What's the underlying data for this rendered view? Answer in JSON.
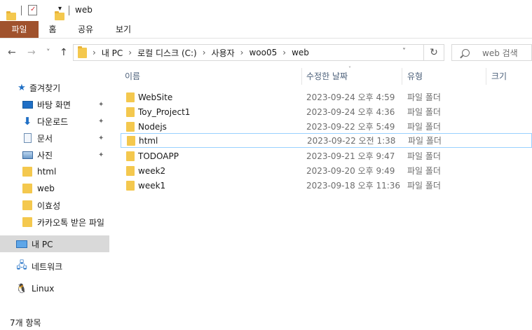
{
  "title": {
    "text": "web",
    "dropdown_glyph": "▾"
  },
  "ribbon": {
    "tabs": [
      {
        "label": "파일",
        "active": true
      },
      {
        "label": "홈"
      },
      {
        "label": "공유"
      },
      {
        "label": "보기"
      }
    ]
  },
  "nav": {
    "back": "←",
    "forward": "→",
    "recent": "˅",
    "up": "↑",
    "address": {
      "crumbs": [
        "내 PC",
        "로컬 디스크 (C:)",
        "사용자",
        "woo05",
        "web"
      ],
      "chevron": "›",
      "dropdown": "˅"
    },
    "refresh": "↻",
    "search_placeholder": "web 검색"
  },
  "sidebar": {
    "items": [
      {
        "label": "즐겨찾기",
        "icon": "star-icon"
      },
      {
        "label": "바탕 화면",
        "icon": "desktop-icon",
        "pinned": true
      },
      {
        "label": "다운로드",
        "icon": "download-icon",
        "pinned": true
      },
      {
        "label": "문서",
        "icon": "document-icon",
        "pinned": true
      },
      {
        "label": "사진",
        "icon": "pictures-icon",
        "pinned": true
      },
      {
        "label": "html",
        "icon": "folder-icon"
      },
      {
        "label": "web",
        "icon": "folder-icon"
      },
      {
        "label": "이효성",
        "icon": "folder-icon"
      },
      {
        "label": "카카오톡 받은 파일",
        "icon": "folder-icon"
      },
      {
        "label": "내 PC",
        "icon": "pc-icon",
        "selected": true
      },
      {
        "label": "네트워크",
        "icon": "network-icon"
      },
      {
        "label": "Linux",
        "icon": "linux-icon"
      }
    ],
    "pin_glyph": "📌"
  },
  "columns": {
    "name": "이름",
    "modified": "수정한 날짜",
    "type": "유형",
    "size": "크기"
  },
  "files": [
    {
      "name": "WebSite",
      "modified": "2023-09-24 오후 4:59",
      "type": "파일 폴더"
    },
    {
      "name": "Toy_Project1",
      "modified": "2023-09-24 오후 4:36",
      "type": "파일 폴더"
    },
    {
      "name": "Nodejs",
      "modified": "2023-09-22 오후 5:49",
      "type": "파일 폴더"
    },
    {
      "name": "html",
      "modified": "2023-09-22 오전 1:38",
      "type": "파일 폴더",
      "hover": true
    },
    {
      "name": "TODOAPP",
      "modified": "2023-09-21 오후 9:47",
      "type": "파일 폴더"
    },
    {
      "name": "week2",
      "modified": "2023-09-20 오후 9:49",
      "type": "파일 폴더"
    },
    {
      "name": "week1",
      "modified": "2023-09-18 오후 11:36",
      "type": "파일 폴더"
    }
  ],
  "status": {
    "item_count": "7개 항목"
  },
  "colors": {
    "file_tab": "#a0522d",
    "folder": "#f4c84e",
    "selection": "#d9d9d9",
    "hover_border": "#99d1ff"
  }
}
